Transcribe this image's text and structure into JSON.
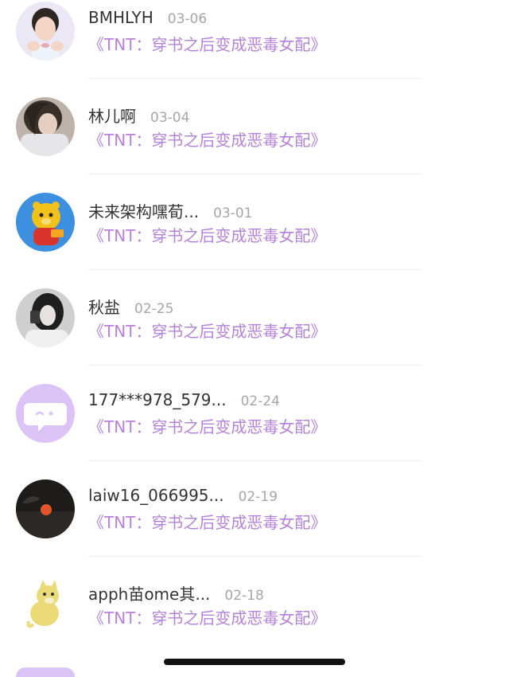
{
  "items": [
    {
      "name": "BMHLYH",
      "date": "03-06",
      "work": "《TNT：穿书之后变成恶毒女配》",
      "avatar": "boy-heart-hands-photo"
    },
    {
      "name": "林儿啊",
      "date": "03-04",
      "work": "《TNT：穿书之后变成恶毒女配》",
      "avatar": "girl-dark-hair-photo"
    },
    {
      "name": "未来架构嘿荀...",
      "date": "03-01",
      "work": "《TNT：穿书之后变成恶毒女配》",
      "avatar": "cartoon-bear-blue-bg"
    },
    {
      "name": "秋盐",
      "date": "02-25",
      "work": "《TNT：穿书之后变成恶毒女配》",
      "avatar": "girl-selfie-photo"
    },
    {
      "name": "177***978_579...",
      "date": "02-24",
      "work": "《TNT：穿书之后变成恶毒女配》",
      "avatar": "default-chat-bubble-avatar"
    },
    {
      "name": "laiw16_066995...",
      "date": "02-19",
      "work": "《TNT：穿书之后变成恶毒女配》",
      "avatar": "sunset-landscape-photo"
    },
    {
      "name": "apph苗ome其...",
      "date": "02-18",
      "work": "《TNT：穿书之后变成恶毒女配》",
      "avatar": "doge-cartoon"
    }
  ],
  "colors": {
    "name": "#333333",
    "date": "#a6a6a6",
    "work_title": "#b483d8",
    "default_avatar": "#dcc3f5"
  }
}
